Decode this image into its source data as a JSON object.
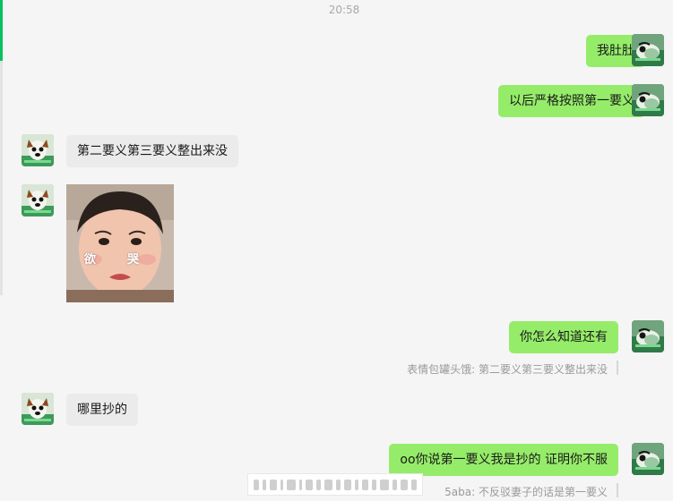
{
  "chat": {
    "timestamp": "20:58",
    "messages": [
      {
        "side": "me",
        "text": "我肚肚"
      },
      {
        "side": "me",
        "text": "以后严格按照第一要义"
      },
      {
        "side": "other",
        "text": "第二要义第三要义整出来没"
      },
      {
        "side": "other",
        "type": "sticker",
        "caption_left": "欲",
        "caption_right": "哭"
      },
      {
        "side": "me",
        "text": "你怎么知道还有"
      },
      {
        "side": "me",
        "quote": "表情包罐头饿: 第二要义第三要义整出来没"
      },
      {
        "side": "other",
        "text": "哪里抄的"
      },
      {
        "side": "me",
        "text": "oo你说第一要义我是抄的   证明你不服"
      },
      {
        "side": "me",
        "quote": "5aba: 不反驳妻子的话是第一要义"
      }
    ]
  },
  "colors": {
    "accent": "#07c160",
    "my_bubble": "#95ec69",
    "other_bubble": "#ebebeb",
    "background": "#f5f5f5"
  },
  "icons": {
    "avatar": "cartoon-dog-avatar"
  }
}
